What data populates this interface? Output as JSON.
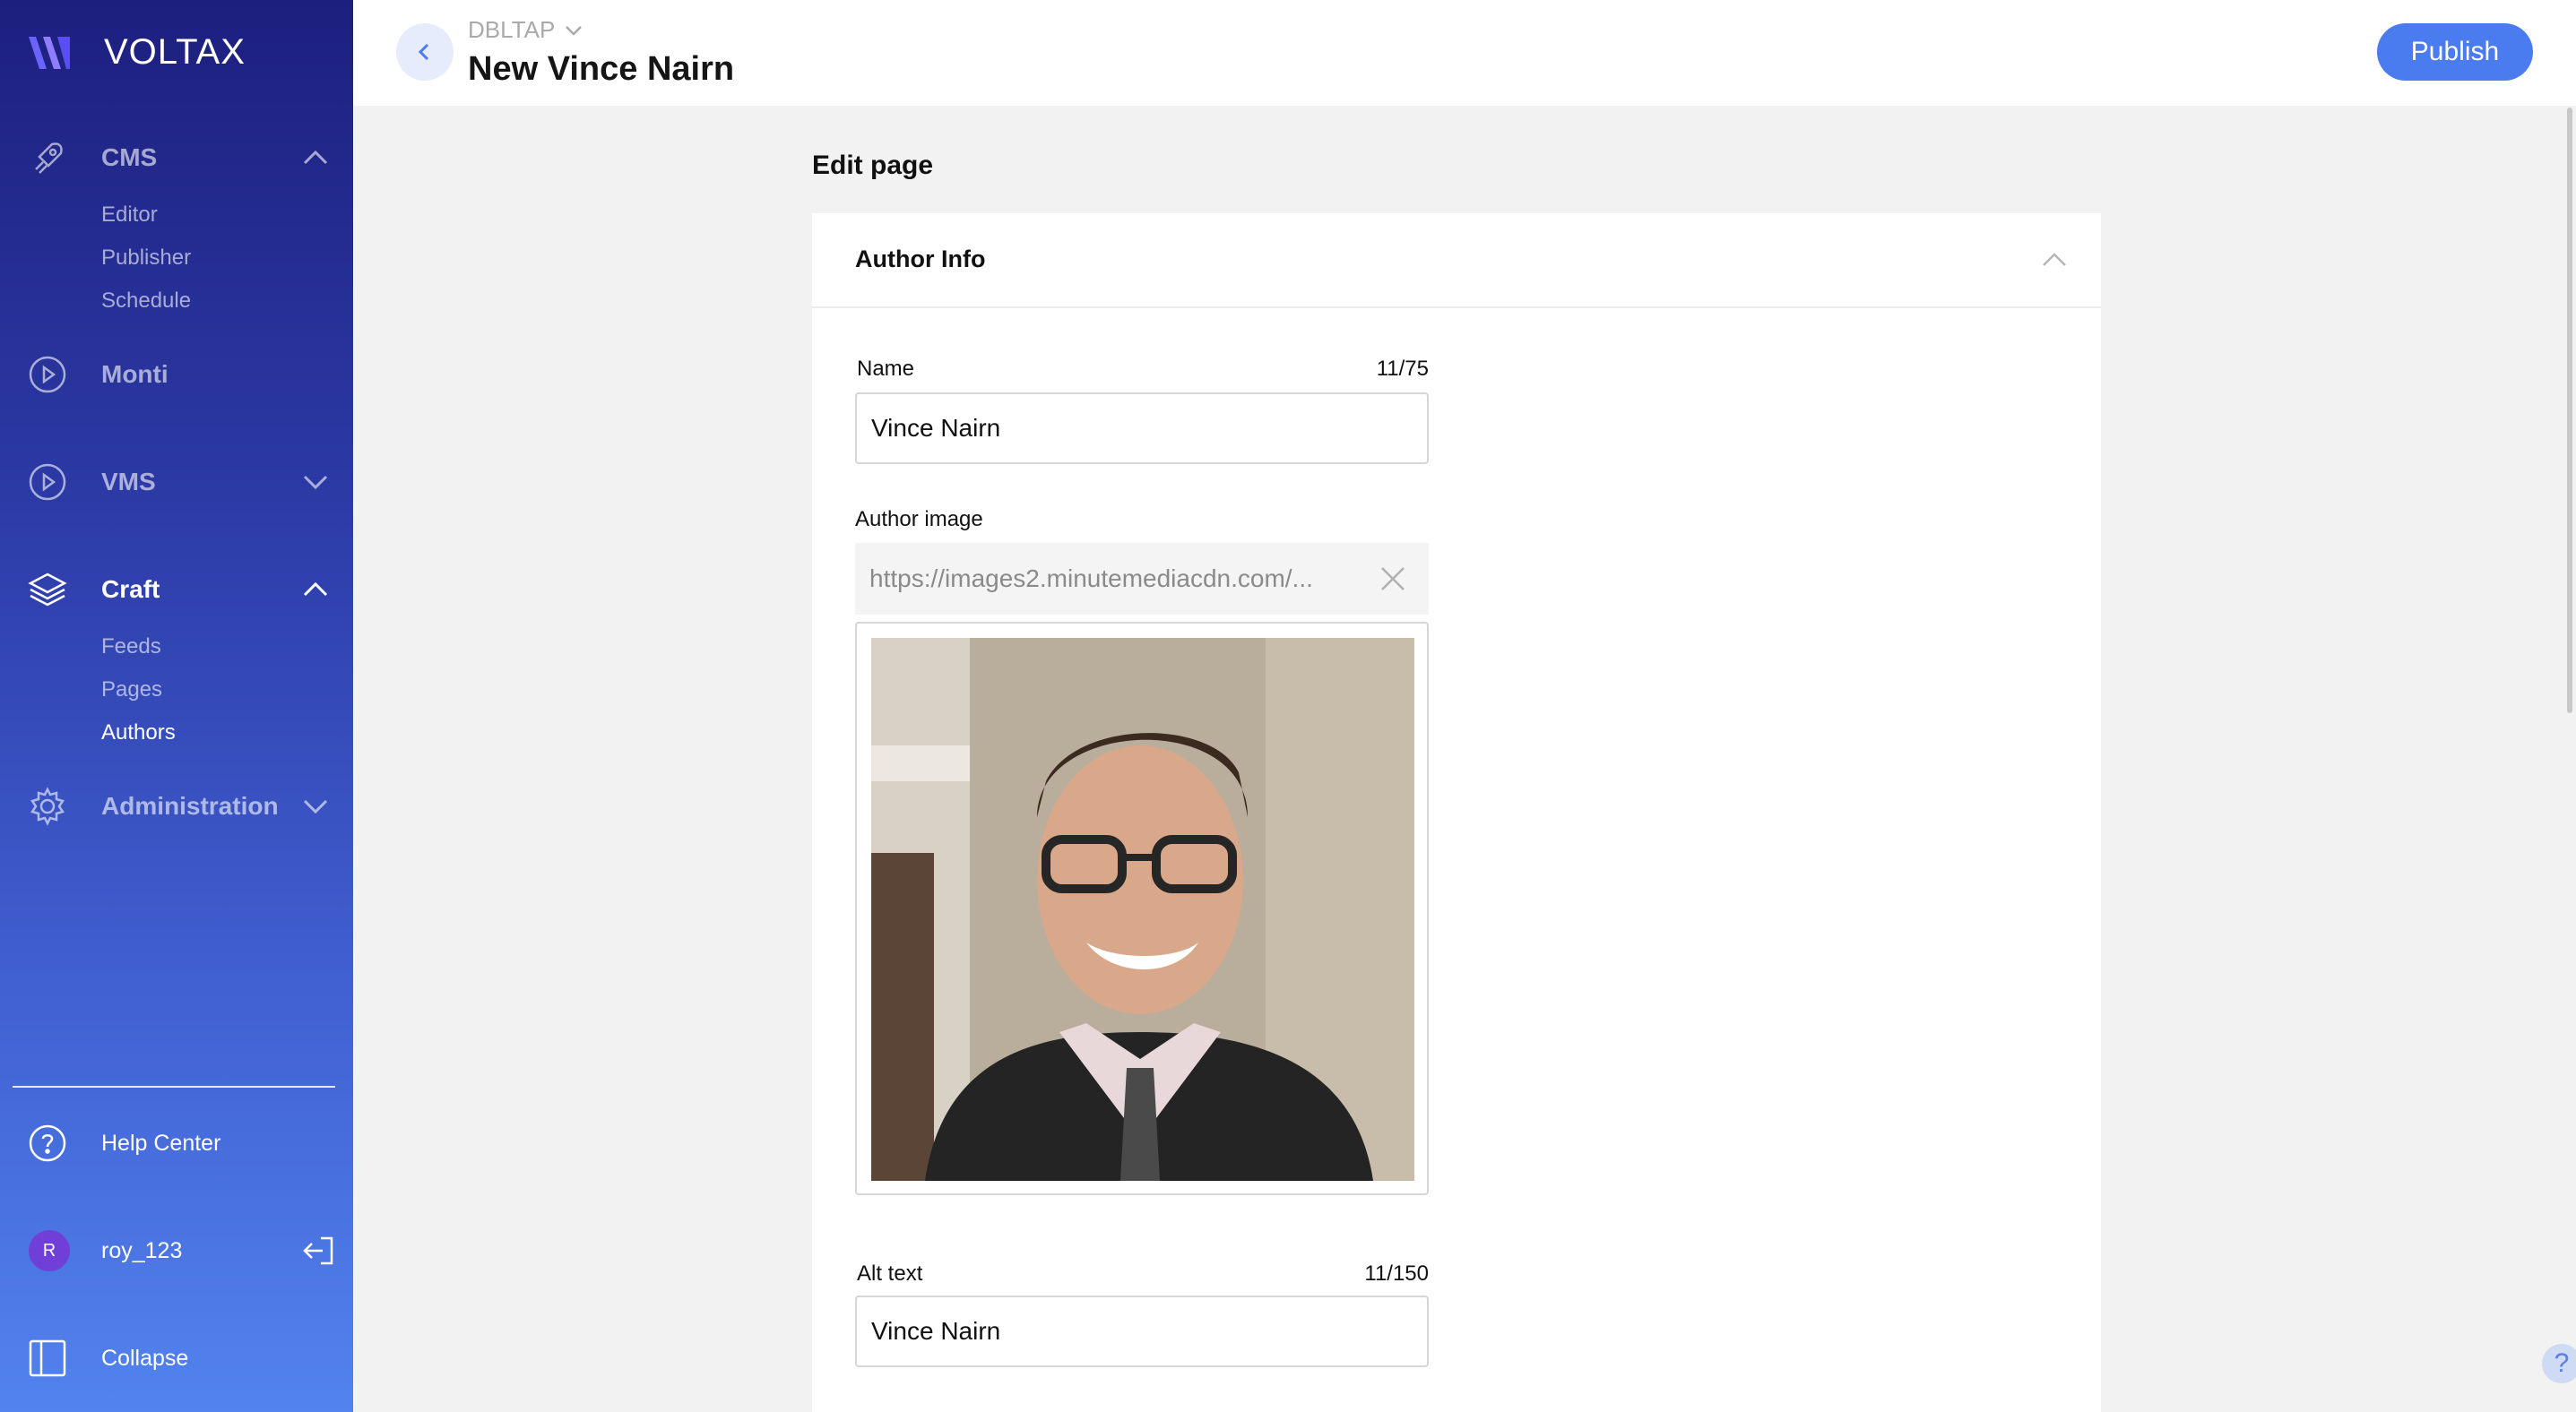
{
  "app": {
    "brand_name": "VOLTAX",
    "brand_color": "#7b5cf0"
  },
  "sidebar": {
    "sections": [
      {
        "label": "CMS",
        "icon": "rocket-icon",
        "expanded": true,
        "items": [
          "Editor",
          "Publisher",
          "Schedule"
        ]
      },
      {
        "label": "Monti",
        "icon": "play-circle-icon"
      },
      {
        "label": "VMS",
        "icon": "play-circle-icon",
        "expanded": false
      },
      {
        "label": "Craft",
        "icon": "layers-icon",
        "expanded": true,
        "active": true,
        "items": [
          "Feeds",
          "Pages",
          "Authors"
        ],
        "active_item": "Authors"
      },
      {
        "label": "Administration",
        "icon": "gear-icon",
        "expanded": false
      }
    ],
    "help_label": "Help Center",
    "user_initial": "R",
    "username": "roy_123",
    "collapse_label": "Collapse"
  },
  "topbar": {
    "site": "DBLTAP",
    "title": "New Vince Nairn",
    "publish_label": "Publish",
    "publish_color": "#4a7cf0"
  },
  "content": {
    "heading": "Edit page",
    "card_title": "Author Info",
    "name_label": "Name",
    "name_counter": "11/75",
    "name_value": "Vince Nairn",
    "image_label": "Author image",
    "image_url": "https://images2.minutemediacdn.com/...",
    "alt_label": "Alt text",
    "alt_counter": "11/150",
    "alt_value": "Vince Nairn"
  },
  "help_bubble": "?"
}
